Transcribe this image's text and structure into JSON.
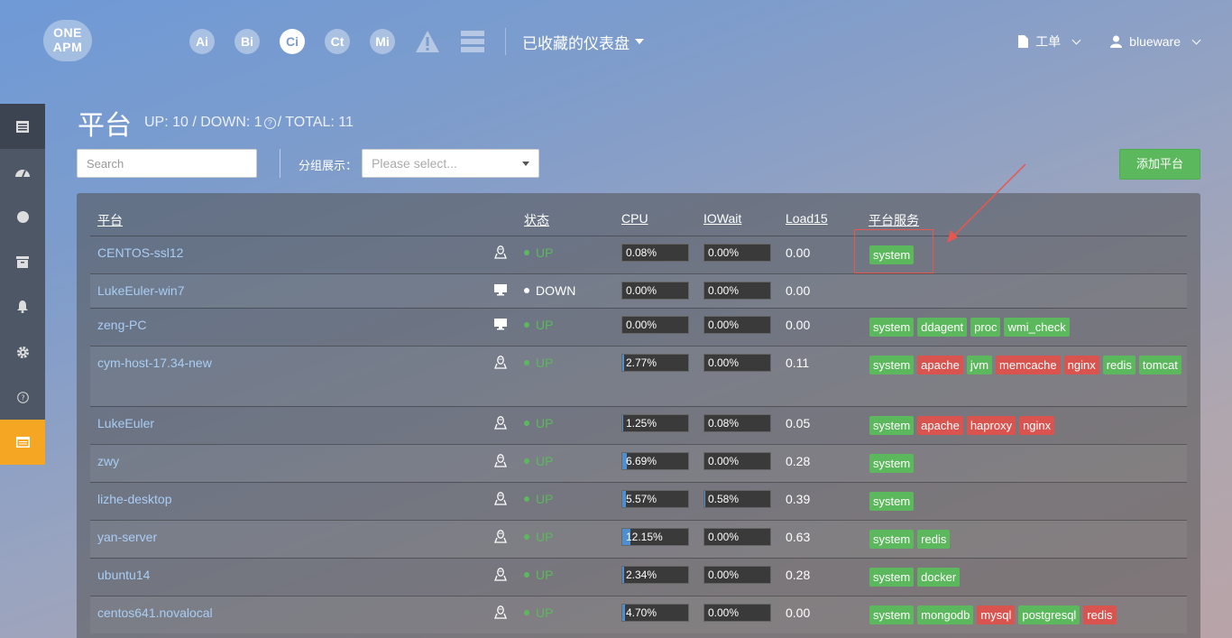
{
  "logo": {
    "line1": "ONE",
    "line2": "APM"
  },
  "topnav": {
    "apps": [
      {
        "label": "Ai",
        "active": false
      },
      {
        "label": "Bi",
        "active": false
      },
      {
        "label": "Ci",
        "active": true
      },
      {
        "label": "Ct",
        "active": false
      },
      {
        "label": "Mi",
        "active": false
      }
    ],
    "dashboard_label": "已收藏的仪表盘",
    "workorder_label": "工单",
    "user_label": "blueware"
  },
  "sidebar": {
    "items": [
      {
        "icon": "platform-list-icon",
        "active": "top"
      },
      {
        "icon": "dashboard-icon"
      },
      {
        "icon": "circle-icon"
      },
      {
        "icon": "archive-icon"
      },
      {
        "icon": "bell-icon"
      },
      {
        "icon": "gear-icon"
      },
      {
        "icon": "help-icon"
      },
      {
        "icon": "window-icon",
        "active": "orange"
      }
    ]
  },
  "header": {
    "title": "平台",
    "stats_up": "UP: 10 / DOWN: 1",
    "stats_total": " / TOTAL: 11",
    "help_glyph": "?"
  },
  "toolbar": {
    "search_placeholder": "Search",
    "group_label": "分组展示：",
    "select_placeholder": "Please select...",
    "add_button": "添加平台"
  },
  "table": {
    "headers": {
      "platform": "平台",
      "status": "状态",
      "cpu": "CPU",
      "iowait": "IOWait",
      "load15": "Load15",
      "services": "平台服务"
    },
    "rows": [
      {
        "host": "CENTOS-ssl12",
        "os": "linux",
        "status": "UP",
        "cpu": "0.08%",
        "cpu_pct": 0.08,
        "iowait": "0.00%",
        "iowait_pct": 0,
        "load": "0.00",
        "services": [
          {
            "name": "system",
            "color": "green"
          }
        ]
      },
      {
        "host": "LukeEuler-win7",
        "os": "windows",
        "status": "DOWN",
        "cpu": "0.00%",
        "cpu_pct": 0,
        "iowait": "0.00%",
        "iowait_pct": 0,
        "load": "0.00",
        "services": []
      },
      {
        "host": "zeng-PC",
        "os": "windows",
        "status": "UP",
        "cpu": "0.00%",
        "cpu_pct": 0,
        "iowait": "0.00%",
        "iowait_pct": 0,
        "load": "0.00",
        "services": [
          {
            "name": "system",
            "color": "green"
          },
          {
            "name": "ddagent",
            "color": "green"
          },
          {
            "name": "proc",
            "color": "green"
          },
          {
            "name": "wmi_check",
            "color": "green"
          }
        ]
      },
      {
        "host": "cym-host-17.34-new",
        "os": "linux",
        "status": "UP",
        "cpu": "2.77%",
        "cpu_pct": 2.77,
        "iowait": "0.00%",
        "iowait_pct": 0,
        "load": "0.11",
        "services": [
          {
            "name": "system",
            "color": "green"
          },
          {
            "name": "apache",
            "color": "red"
          },
          {
            "name": "jvm",
            "color": "green"
          },
          {
            "name": "memcache",
            "color": "red"
          },
          {
            "name": "nginx",
            "color": "red"
          },
          {
            "name": "redis",
            "color": "green"
          },
          {
            "name": "tomcat",
            "color": "green"
          }
        ]
      },
      {
        "host": "LukeEuler",
        "os": "linux",
        "status": "UP",
        "cpu": "1.25%",
        "cpu_pct": 1.25,
        "iowait": "0.08%",
        "iowait_pct": 0.08,
        "load": "0.05",
        "services": [
          {
            "name": "system",
            "color": "green"
          },
          {
            "name": "apache",
            "color": "red"
          },
          {
            "name": "haproxy",
            "color": "red"
          },
          {
            "name": "nginx",
            "color": "red"
          }
        ]
      },
      {
        "host": "zwy",
        "os": "linux",
        "status": "UP",
        "cpu": "6.69%",
        "cpu_pct": 6.69,
        "iowait": "0.00%",
        "iowait_pct": 0,
        "load": "0.28",
        "services": [
          {
            "name": "system",
            "color": "green"
          }
        ]
      },
      {
        "host": "lizhe-desktop",
        "os": "linux",
        "status": "UP",
        "cpu": "5.57%",
        "cpu_pct": 5.57,
        "iowait": "0.58%",
        "iowait_pct": 0.58,
        "load": "0.39",
        "services": [
          {
            "name": "system",
            "color": "green"
          }
        ]
      },
      {
        "host": "yan-server",
        "os": "linux",
        "status": "UP",
        "cpu": "12.15%",
        "cpu_pct": 12.15,
        "iowait": "0.00%",
        "iowait_pct": 0,
        "load": "0.63",
        "services": [
          {
            "name": "system",
            "color": "green"
          },
          {
            "name": "redis",
            "color": "green"
          }
        ]
      },
      {
        "host": "ubuntu14",
        "os": "linux",
        "status": "UP",
        "cpu": "2.34%",
        "cpu_pct": 2.34,
        "iowait": "0.00%",
        "iowait_pct": 0,
        "load": "0.28",
        "services": [
          {
            "name": "system",
            "color": "green"
          },
          {
            "name": "docker",
            "color": "green"
          }
        ]
      },
      {
        "host": "centos641.novalocal",
        "os": "linux",
        "status": "UP",
        "cpu": "4.70%",
        "cpu_pct": 4.7,
        "iowait": "0.00%",
        "iowait_pct": 0,
        "load": "0.00",
        "services": [
          {
            "name": "system",
            "color": "green"
          },
          {
            "name": "mongodb",
            "color": "green"
          },
          {
            "name": "mysql",
            "color": "red"
          },
          {
            "name": "postgresql",
            "color": "green"
          },
          {
            "name": "redis",
            "color": "red"
          }
        ]
      }
    ]
  },
  "colors": {
    "up": "#5cb85c",
    "down": "#ffffff",
    "tag_green": "#5cb85c",
    "tag_red": "#d9534f",
    "annotation": "#e8574d"
  }
}
